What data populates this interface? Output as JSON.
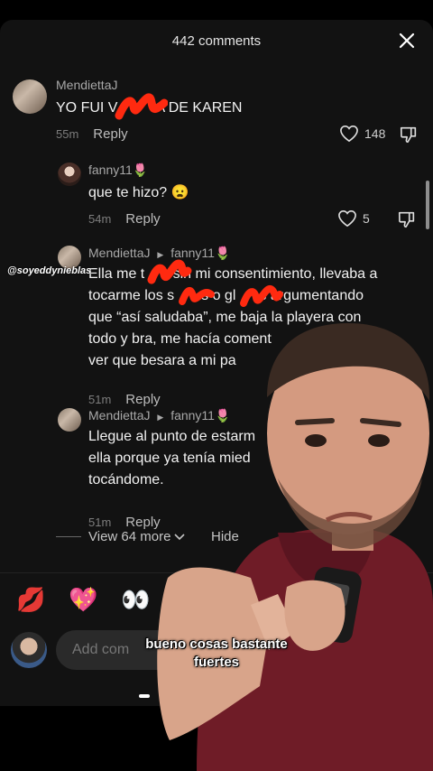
{
  "header": {
    "comment_count": "442 comments"
  },
  "comments": [
    {
      "user": "MendiettaJ",
      "text": "YO FUI V",
      "text_tail": "A DE KAREN",
      "time": "55m",
      "reply": "Reply",
      "likes": "148"
    },
    {
      "user": "fanny11",
      "user_emoji": "🌷",
      "text": "que te hizo? 😦",
      "time": "54m",
      "reply": "Reply",
      "likes": "5"
    },
    {
      "user": "MendiettaJ",
      "reply_to": "fanny11",
      "reply_to_emoji": "🌷",
      "lines": [
        "Ella me t",
        "a sin mi consentimiento, llevaba a",
        "tocarme los s",
        "s o gl",
        "s argumentando",
        "que “así saludaba”, me baja la playera con",
        "todo y bra, me hacía coment",
        "ver que besara a mi pa"
      ],
      "time": "51m",
      "reply": "Reply"
    },
    {
      "user": "MendiettaJ",
      "reply_to": "fanny11",
      "reply_to_emoji": "🌷",
      "lines": [
        "Llegue al punto de estarm",
        "ella porque ya tenía mied",
        "tocándome."
      ],
      "time": "51m",
      "reply": "Reply"
    }
  ],
  "view_more": "View 64 more",
  "hide": "Hide",
  "emojis": [
    "💋",
    "💖",
    "👀"
  ],
  "input": {
    "placeholder": "Add com"
  },
  "watermark": "@soyeddynieblas",
  "caption": [
    "bueno cosas bastante",
    "fuertes"
  ],
  "colors": {
    "sheet": "#121212",
    "redaction": "#ff2a10",
    "shirt": "#7a1f2a"
  },
  "icons": [
    "close-icon",
    "heart-icon",
    "dislike-icon",
    "chevron-down-icon",
    "triangle-right-icon"
  ]
}
